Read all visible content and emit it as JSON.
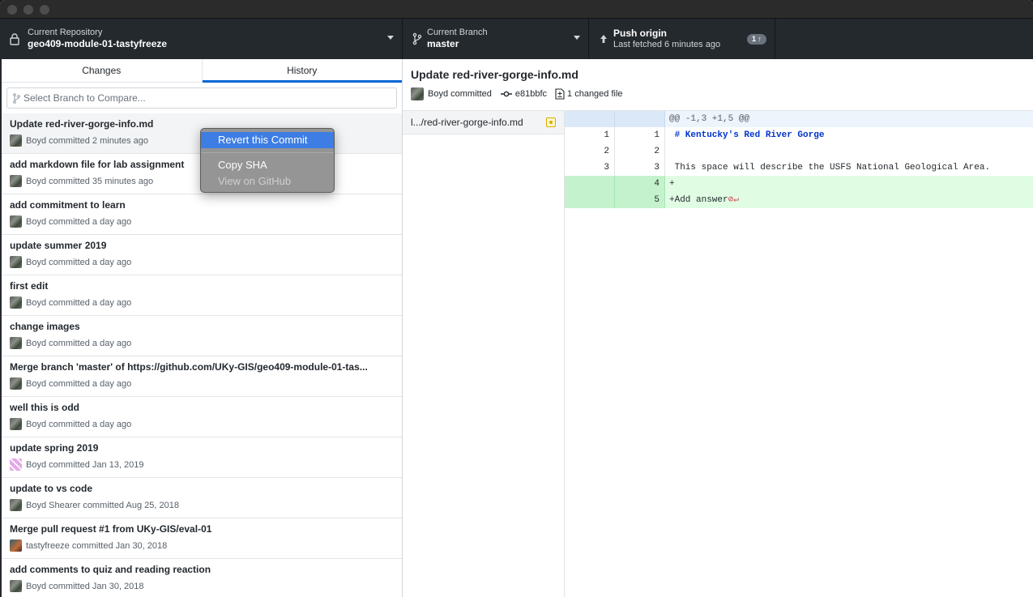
{
  "toolbar": {
    "repo_caption": "Current Repository",
    "repo_name": "geo409-module-01-tastyfreeze",
    "branch_caption": "Current Branch",
    "branch_name": "master",
    "push_title": "Push origin",
    "push_caption": "Last fetched 6 minutes ago",
    "push_badge": "1 ↑"
  },
  "tabs": {
    "changes": "Changes",
    "history": "History"
  },
  "compare": {
    "placeholder": "Select Branch to Compare..."
  },
  "commits": [
    {
      "title": "Update red-river-gorge-info.md",
      "meta": "Boyd committed 2 minutes ago"
    },
    {
      "title": "add markdown file for lab assignment",
      "meta": "Boyd committed 35 minutes ago"
    },
    {
      "title": "add commitment to learn",
      "meta": "Boyd committed a day ago"
    },
    {
      "title": "update summer 2019",
      "meta": "Boyd committed a day ago"
    },
    {
      "title": "first edit",
      "meta": "Boyd committed a day ago"
    },
    {
      "title": "change images",
      "meta": "Boyd committed a day ago"
    },
    {
      "title": "Merge branch 'master' of https://github.com/UKy-GIS/geo409-module-01-tas...",
      "meta": "Boyd committed a day ago"
    },
    {
      "title": "well this is odd",
      "meta": "Boyd committed a day ago"
    },
    {
      "title": "update spring 2019",
      "meta": "Boyd committed Jan 13, 2019"
    },
    {
      "title": "update to vs code",
      "meta": "Boyd Shearer committed Aug 25, 2018"
    },
    {
      "title": "Merge pull request #1 from UKy-GIS/eval-01",
      "meta": "tastyfreeze committed Jan 30, 2018"
    },
    {
      "title": "add comments to quiz and reading reaction",
      "meta": "Boyd committed Jan 30, 2018"
    }
  ],
  "context_menu": {
    "revert": "Revert this Commit",
    "copy_sha": "Copy SHA",
    "view_github": "View on GitHub"
  },
  "commit_detail": {
    "title": "Update red-river-gorge-info.md",
    "author": "Boyd committed",
    "sha": "e81bbfc",
    "changed": "1 changed file"
  },
  "files": [
    {
      "path": "l.../red-river-gorge-info.md"
    }
  ],
  "diff": {
    "hunk": "@@ -1,3 +1,5 @@",
    "lines": [
      {
        "old": "1",
        "new": "1",
        "text": " # Kentucky's Red River Gorge"
      },
      {
        "old": "2",
        "new": "2",
        "text": ""
      },
      {
        "old": "3",
        "new": "3",
        "text": " This space will describe the USFS National Geological Area."
      },
      {
        "old": "",
        "new": "4",
        "text": "+"
      },
      {
        "old": "",
        "new": "5",
        "text": "+Add answer"
      }
    ]
  }
}
